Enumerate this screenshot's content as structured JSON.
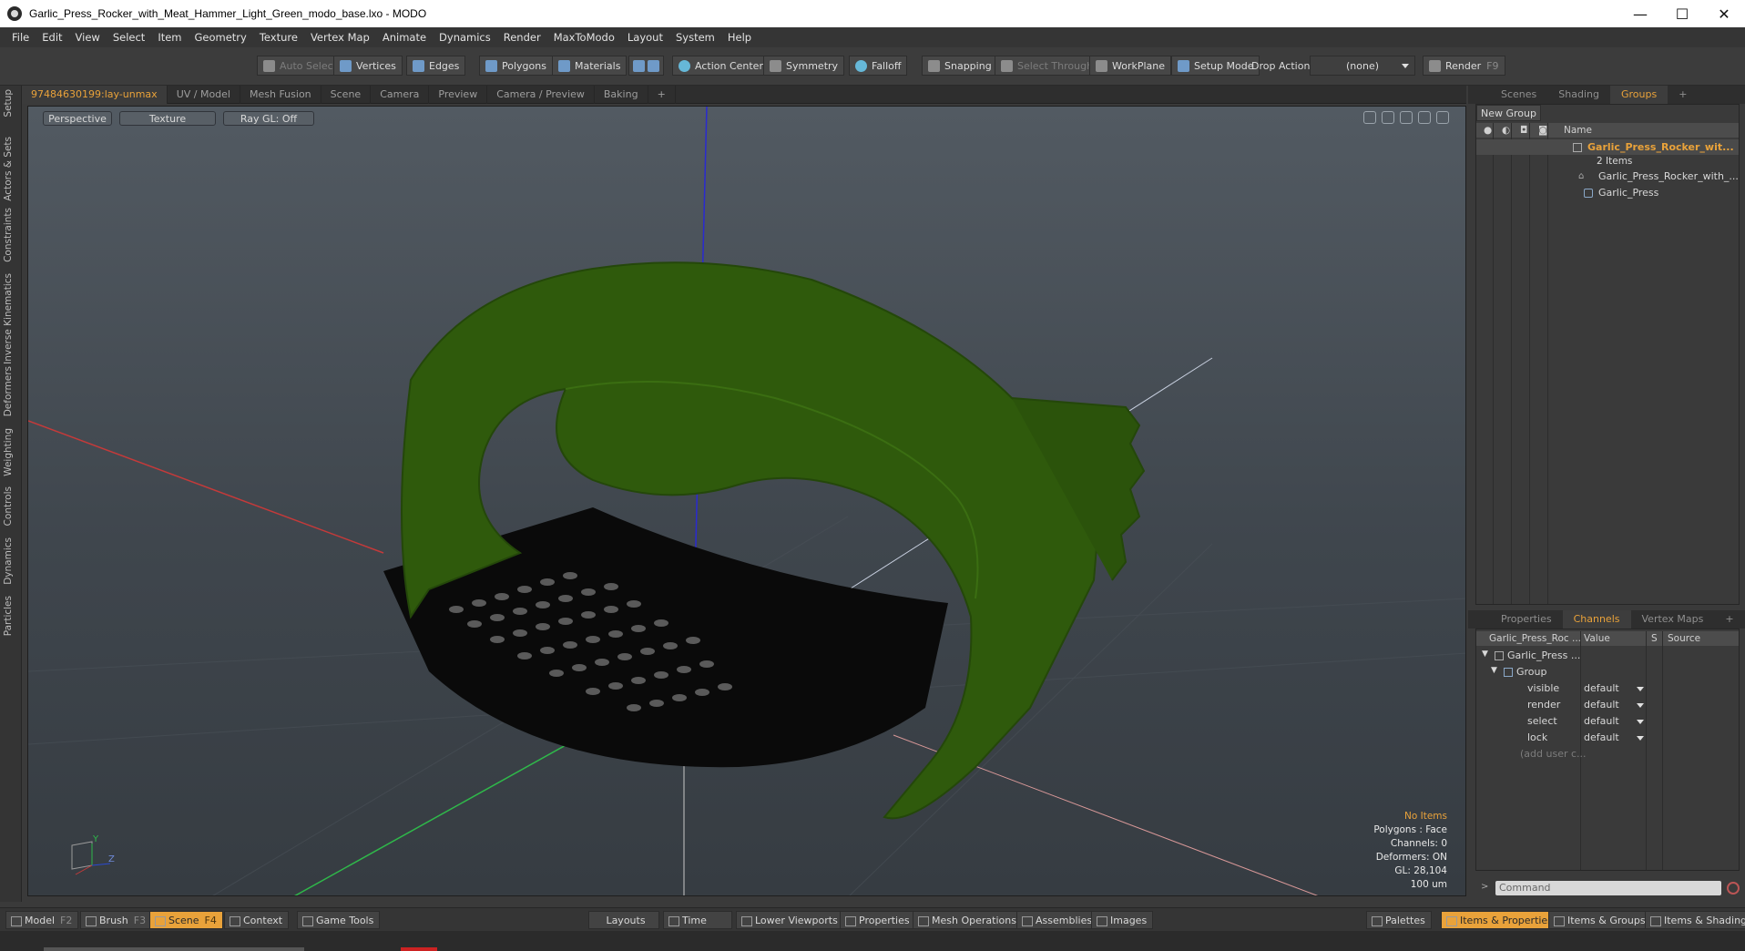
{
  "window": {
    "title": "Garlic_Press_Rocker_with_Meat_Hammer_Light_Green_modo_base.lxo - MODO",
    "minimize": "—",
    "maximize": "☐",
    "close": "✕"
  },
  "menu": [
    "File",
    "Edit",
    "View",
    "Select",
    "Item",
    "Geometry",
    "Texture",
    "Vertex Map",
    "Animate",
    "Dynamics",
    "Render",
    "MaxToModo",
    "Layout",
    "System",
    "Help"
  ],
  "toolbar": {
    "auto_select": "Auto Select",
    "vertices": "Vertices",
    "edges": "Edges",
    "polygons": "Polygons",
    "materials": "Materials",
    "action_center": "Action Center",
    "symmetry": "Symmetry",
    "falloff": "Falloff",
    "snapping": "Snapping",
    "select_through": "Select Through",
    "workplane": "WorkPlane",
    "setup_mode": "Setup Mode",
    "drop_action_label": "Drop Action",
    "drop_action_value": "(none)",
    "render": "Render",
    "render_key": "F9"
  },
  "left_tabs": [
    "Setup",
    "Actors & Sets",
    "Constraints",
    "Inverse Kinematics",
    "Deformers",
    "Weighting",
    "Controls",
    "Dynamics",
    "Particles"
  ],
  "viewport_tabs": [
    "97484630199:lay-unmax",
    "UV / Model",
    "Mesh Fusion",
    "Scene",
    "Camera",
    "Preview",
    "Camera / Preview",
    "Baking",
    "+"
  ],
  "viewport": {
    "perspective": "Perspective",
    "texture": "Texture",
    "raygl": "Ray GL: Off",
    "stats": {
      "items": "No Items",
      "polygons": "Polygons : Face",
      "channels": "Channels: 0",
      "deformers": "Deformers: ON",
      "gl": "GL: 28,104",
      "scale": "100 um"
    },
    "axis_y": "Y",
    "axis_z": "Z"
  },
  "right_tabs_top": [
    "Scenes",
    "Shading",
    "Groups",
    "+"
  ],
  "groups": {
    "new_group": "New Group",
    "name_header": "Name",
    "group_name": "Garlic_Press_Rocker_wit...",
    "group_count": "2 Items",
    "children": [
      "Garlic_Press_Rocker_with_...",
      "Garlic_Press"
    ]
  },
  "right_tabs_bottom": [
    "Properties",
    "Channels",
    "Vertex Maps",
    "+"
  ],
  "channels": {
    "headers": {
      "name": "Garlic_Press_Roc ...",
      "value": "Value",
      "s": "S",
      "source": "Source"
    },
    "root": "Garlic_Press ...",
    "group": "Group",
    "rows": [
      {
        "name": "visible",
        "value": "default"
      },
      {
        "name": "render",
        "value": "default"
      },
      {
        "name": "select",
        "value": "default"
      },
      {
        "name": "lock",
        "value": "default"
      }
    ],
    "add_user": "(add user c..."
  },
  "command": {
    "placeholder": "Command"
  },
  "bottom": {
    "model": "Model",
    "model_key": "F2",
    "brush": "Brush",
    "brush_key": "F3",
    "scene": "Scene",
    "scene_key": "F4",
    "context": "Context",
    "game_tools": "Game Tools",
    "layouts": "Layouts",
    "time": "Time",
    "lower_viewports": "Lower Viewports",
    "properties": "Properties",
    "mesh_operations": "Mesh Operations",
    "assemblies": "Assemblies",
    "images": "Images",
    "palettes": "Palettes",
    "items_properties": "Items & Properties",
    "items_groups": "Items & Groups",
    "items_shading": "Items & Shading"
  },
  "colors": {
    "accent": "#e9a23a",
    "mesh_green": "#2f5a0c",
    "mesh_black": "#0a0a0a"
  }
}
